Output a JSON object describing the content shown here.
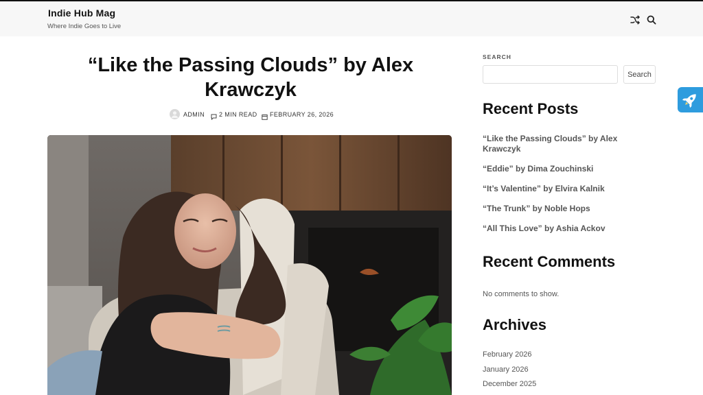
{
  "header": {
    "site_title": "Indie Hub Mag",
    "tagline": "Where Indie Goes to Live",
    "icons": [
      "shuffle-icon",
      "search-icon"
    ]
  },
  "post": {
    "title": "“Like the Passing Clouds” by Alex Krawczyk",
    "meta": {
      "author": "ADMIN",
      "read_time": "2 MIN READ",
      "date": "FEBRUARY 26, 2026"
    },
    "featured_image": "photo of a smiling woman with long dark hair in a black t-shirt leaning on a cream sofa cushion, wooden paneling and a plant in the background"
  },
  "sidebar": {
    "search": {
      "label": "SEARCH",
      "placeholder": "",
      "button": "Search"
    },
    "recent_posts": {
      "heading": "Recent Posts",
      "items": [
        "“Like the Passing Clouds” by Alex Krawczyk",
        "“Eddie” by Dima Zouchinski",
        "“It’s Valentine” by Elvira Kalnik",
        "“The Trunk” by Noble Hops",
        "“All This Love” by Ashia Ackov"
      ]
    },
    "recent_comments": {
      "heading": "Recent Comments",
      "empty_text": "No comments to show."
    },
    "archives": {
      "heading": "Archives",
      "items": [
        "February 2026",
        "January 2026",
        "December 2025"
      ]
    }
  },
  "floating": {
    "icon": "rocket-icon",
    "color": "#2e9cde"
  }
}
